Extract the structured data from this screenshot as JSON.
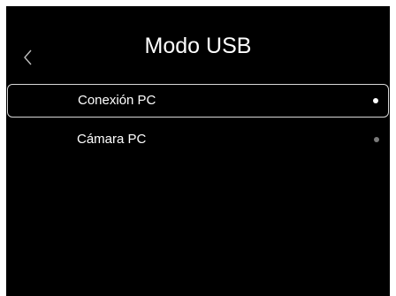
{
  "header": {
    "title": "Modo USB",
    "back_icon": "chevron-left-icon"
  },
  "menu": {
    "items": [
      {
        "label": "Conexión PC",
        "selected": true
      },
      {
        "label": "Cámara PC",
        "selected": false
      }
    ]
  },
  "colors": {
    "background": "#000000",
    "text": "#ffffff",
    "selected_dot": "#ffffff",
    "unselected_dot": "#7a7a7a",
    "selection_border": "#d8d8d8"
  }
}
